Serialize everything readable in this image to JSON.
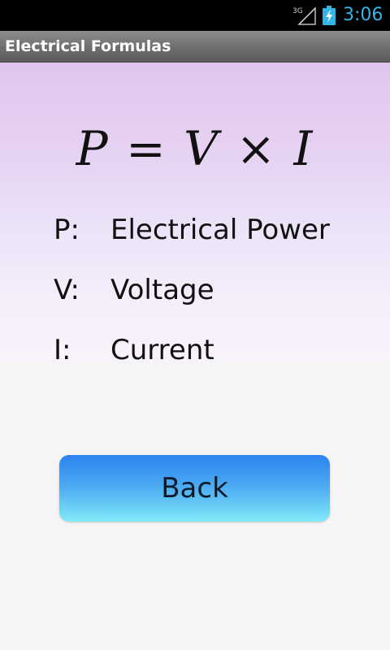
{
  "status_bar": {
    "network_label": "3G",
    "network_icon": "signal-3g-icon",
    "battery_icon": "battery-charging-icon",
    "time": "3:06",
    "time_color": "#33b5e5"
  },
  "title_bar": {
    "title": "Electrical Formulas"
  },
  "formula": {
    "lhs": "P",
    "equals": "=",
    "v": "V",
    "times": "×",
    "i": "I"
  },
  "definitions": [
    {
      "symbol": "P:",
      "meaning": "Electrical Power"
    },
    {
      "symbol": "V:",
      "meaning": "Voltage"
    },
    {
      "symbol": "I:",
      "meaning": "Current"
    }
  ],
  "back_button": {
    "label": "Back"
  }
}
